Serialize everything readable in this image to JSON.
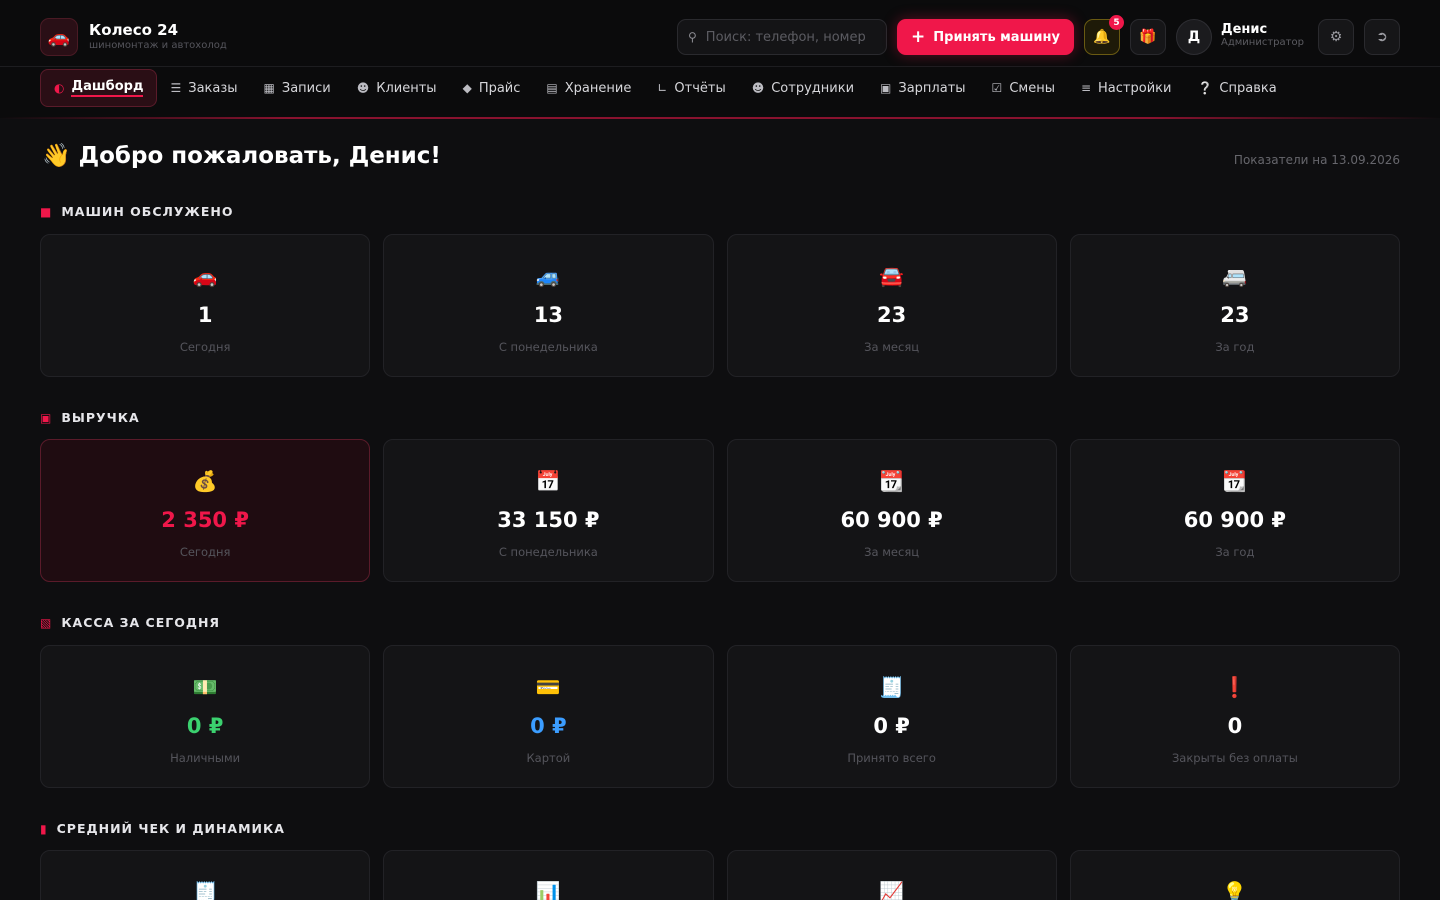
{
  "header": {
    "logo_icon": "🚗",
    "app_name": "Колесо 24",
    "app_subtitle": "шиномонтаж и автохолод",
    "search_placeholder": "Поиск: телефон, номер",
    "accept_button": "Принять машину",
    "notifications_count": "5",
    "user_initial": "Д",
    "user_name": "Денис",
    "user_role": "Администратор"
  },
  "nav": {
    "items": [
      {
        "label": "Дашборд",
        "icon": "dashboard-icon"
      },
      {
        "label": "Заказы",
        "icon": "list-icon"
      },
      {
        "label": "Записи",
        "icon": "calendar-icon"
      },
      {
        "label": "Клиенты",
        "icon": "users-icon"
      },
      {
        "label": "Прайс",
        "icon": "tag-icon"
      },
      {
        "label": "Хранение",
        "icon": "warehouse-icon"
      },
      {
        "label": "Отчёты",
        "icon": "chart-icon"
      },
      {
        "label": "Сотрудники",
        "icon": "employees-icon"
      },
      {
        "label": "Зарплаты",
        "icon": "money-icon"
      },
      {
        "label": "Смены",
        "icon": "shift-icon"
      },
      {
        "label": "Настройки",
        "icon": "sliders-icon"
      },
      {
        "label": "Справка",
        "icon": "help-icon"
      }
    ]
  },
  "main": {
    "welcome": "👋 Добро пожаловать, Денис!",
    "date_note": "Показатели на 13.09.2026",
    "cars_section": {
      "title": "МАШИН ОБСЛУЖЕНО",
      "cards": [
        {
          "icon": "🚗",
          "value": "1",
          "label": "Сегодня"
        },
        {
          "icon": "🚙",
          "value": "13",
          "label": "С понедельника"
        },
        {
          "icon": "🚘",
          "value": "23",
          "label": "За месяц"
        },
        {
          "icon": "🚐",
          "value": "23",
          "label": "За год"
        }
      ]
    },
    "revenue_section": {
      "title": "ВЫРУЧКА",
      "cards": [
        {
          "icon": "💰",
          "value": "2 350 ₽",
          "label": "Сегодня"
        },
        {
          "icon": "📅",
          "value": "33 150 ₽",
          "label": "С понедельника"
        },
        {
          "icon": "📆",
          "value": "60 900 ₽",
          "label": "За месяц"
        },
        {
          "icon": "📆",
          "value": "60 900 ₽",
          "label": "За год"
        }
      ]
    },
    "cash_section": {
      "title": "КАССА ЗА СЕГОДНЯ",
      "cards": [
        {
          "icon": "💵",
          "value": "0 ₽",
          "label": "Наличными"
        },
        {
          "icon": "💳",
          "value": "0 ₽",
          "label": "Картой"
        },
        {
          "icon": "🧾",
          "value": "0 ₽",
          "label": "Принято всего"
        },
        {
          "icon": "❗",
          "value": "0",
          "label": "Закрыты без оплаты"
        }
      ]
    },
    "avg_section": {
      "title": "СРЕДНИЙ ЧЕК И ДИНАМИКА",
      "cards": [
        {
          "icon": "🧾"
        },
        {
          "icon": "📊"
        },
        {
          "icon": "📈"
        },
        {
          "icon": "💡"
        }
      ]
    }
  },
  "colors": {
    "accent": "#f0174a",
    "background": "#0e0e10",
    "card": "#141416",
    "cash_green": "#3bd16f",
    "card_blue": "#3b9dff"
  }
}
